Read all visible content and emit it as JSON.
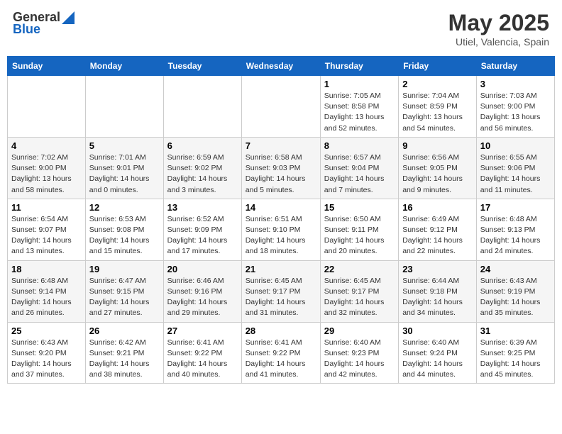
{
  "header": {
    "logo_general": "General",
    "logo_blue": "Blue",
    "month": "May 2025",
    "location": "Utiel, Valencia, Spain"
  },
  "days_of_week": [
    "Sunday",
    "Monday",
    "Tuesday",
    "Wednesday",
    "Thursday",
    "Friday",
    "Saturday"
  ],
  "weeks": [
    [
      {
        "day": "",
        "info": ""
      },
      {
        "day": "",
        "info": ""
      },
      {
        "day": "",
        "info": ""
      },
      {
        "day": "",
        "info": ""
      },
      {
        "day": "1",
        "info": "Sunrise: 7:05 AM\nSunset: 8:58 PM\nDaylight: 13 hours\nand 52 minutes."
      },
      {
        "day": "2",
        "info": "Sunrise: 7:04 AM\nSunset: 8:59 PM\nDaylight: 13 hours\nand 54 minutes."
      },
      {
        "day": "3",
        "info": "Sunrise: 7:03 AM\nSunset: 9:00 PM\nDaylight: 13 hours\nand 56 minutes."
      }
    ],
    [
      {
        "day": "4",
        "info": "Sunrise: 7:02 AM\nSunset: 9:00 PM\nDaylight: 13 hours\nand 58 minutes."
      },
      {
        "day": "5",
        "info": "Sunrise: 7:01 AM\nSunset: 9:01 PM\nDaylight: 14 hours\nand 0 minutes."
      },
      {
        "day": "6",
        "info": "Sunrise: 6:59 AM\nSunset: 9:02 PM\nDaylight: 14 hours\nand 3 minutes."
      },
      {
        "day": "7",
        "info": "Sunrise: 6:58 AM\nSunset: 9:03 PM\nDaylight: 14 hours\nand 5 minutes."
      },
      {
        "day": "8",
        "info": "Sunrise: 6:57 AM\nSunset: 9:04 PM\nDaylight: 14 hours\nand 7 minutes."
      },
      {
        "day": "9",
        "info": "Sunrise: 6:56 AM\nSunset: 9:05 PM\nDaylight: 14 hours\nand 9 minutes."
      },
      {
        "day": "10",
        "info": "Sunrise: 6:55 AM\nSunset: 9:06 PM\nDaylight: 14 hours\nand 11 minutes."
      }
    ],
    [
      {
        "day": "11",
        "info": "Sunrise: 6:54 AM\nSunset: 9:07 PM\nDaylight: 14 hours\nand 13 minutes."
      },
      {
        "day": "12",
        "info": "Sunrise: 6:53 AM\nSunset: 9:08 PM\nDaylight: 14 hours\nand 15 minutes."
      },
      {
        "day": "13",
        "info": "Sunrise: 6:52 AM\nSunset: 9:09 PM\nDaylight: 14 hours\nand 17 minutes."
      },
      {
        "day": "14",
        "info": "Sunrise: 6:51 AM\nSunset: 9:10 PM\nDaylight: 14 hours\nand 18 minutes."
      },
      {
        "day": "15",
        "info": "Sunrise: 6:50 AM\nSunset: 9:11 PM\nDaylight: 14 hours\nand 20 minutes."
      },
      {
        "day": "16",
        "info": "Sunrise: 6:49 AM\nSunset: 9:12 PM\nDaylight: 14 hours\nand 22 minutes."
      },
      {
        "day": "17",
        "info": "Sunrise: 6:48 AM\nSunset: 9:13 PM\nDaylight: 14 hours\nand 24 minutes."
      }
    ],
    [
      {
        "day": "18",
        "info": "Sunrise: 6:48 AM\nSunset: 9:14 PM\nDaylight: 14 hours\nand 26 minutes."
      },
      {
        "day": "19",
        "info": "Sunrise: 6:47 AM\nSunset: 9:15 PM\nDaylight: 14 hours\nand 27 minutes."
      },
      {
        "day": "20",
        "info": "Sunrise: 6:46 AM\nSunset: 9:16 PM\nDaylight: 14 hours\nand 29 minutes."
      },
      {
        "day": "21",
        "info": "Sunrise: 6:45 AM\nSunset: 9:17 PM\nDaylight: 14 hours\nand 31 minutes."
      },
      {
        "day": "22",
        "info": "Sunrise: 6:45 AM\nSunset: 9:17 PM\nDaylight: 14 hours\nand 32 minutes."
      },
      {
        "day": "23",
        "info": "Sunrise: 6:44 AM\nSunset: 9:18 PM\nDaylight: 14 hours\nand 34 minutes."
      },
      {
        "day": "24",
        "info": "Sunrise: 6:43 AM\nSunset: 9:19 PM\nDaylight: 14 hours\nand 35 minutes."
      }
    ],
    [
      {
        "day": "25",
        "info": "Sunrise: 6:43 AM\nSunset: 9:20 PM\nDaylight: 14 hours\nand 37 minutes."
      },
      {
        "day": "26",
        "info": "Sunrise: 6:42 AM\nSunset: 9:21 PM\nDaylight: 14 hours\nand 38 minutes."
      },
      {
        "day": "27",
        "info": "Sunrise: 6:41 AM\nSunset: 9:22 PM\nDaylight: 14 hours\nand 40 minutes."
      },
      {
        "day": "28",
        "info": "Sunrise: 6:41 AM\nSunset: 9:22 PM\nDaylight: 14 hours\nand 41 minutes."
      },
      {
        "day": "29",
        "info": "Sunrise: 6:40 AM\nSunset: 9:23 PM\nDaylight: 14 hours\nand 42 minutes."
      },
      {
        "day": "30",
        "info": "Sunrise: 6:40 AM\nSunset: 9:24 PM\nDaylight: 14 hours\nand 44 minutes."
      },
      {
        "day": "31",
        "info": "Sunrise: 6:39 AM\nSunset: 9:25 PM\nDaylight: 14 hours\nand 45 minutes."
      }
    ]
  ]
}
